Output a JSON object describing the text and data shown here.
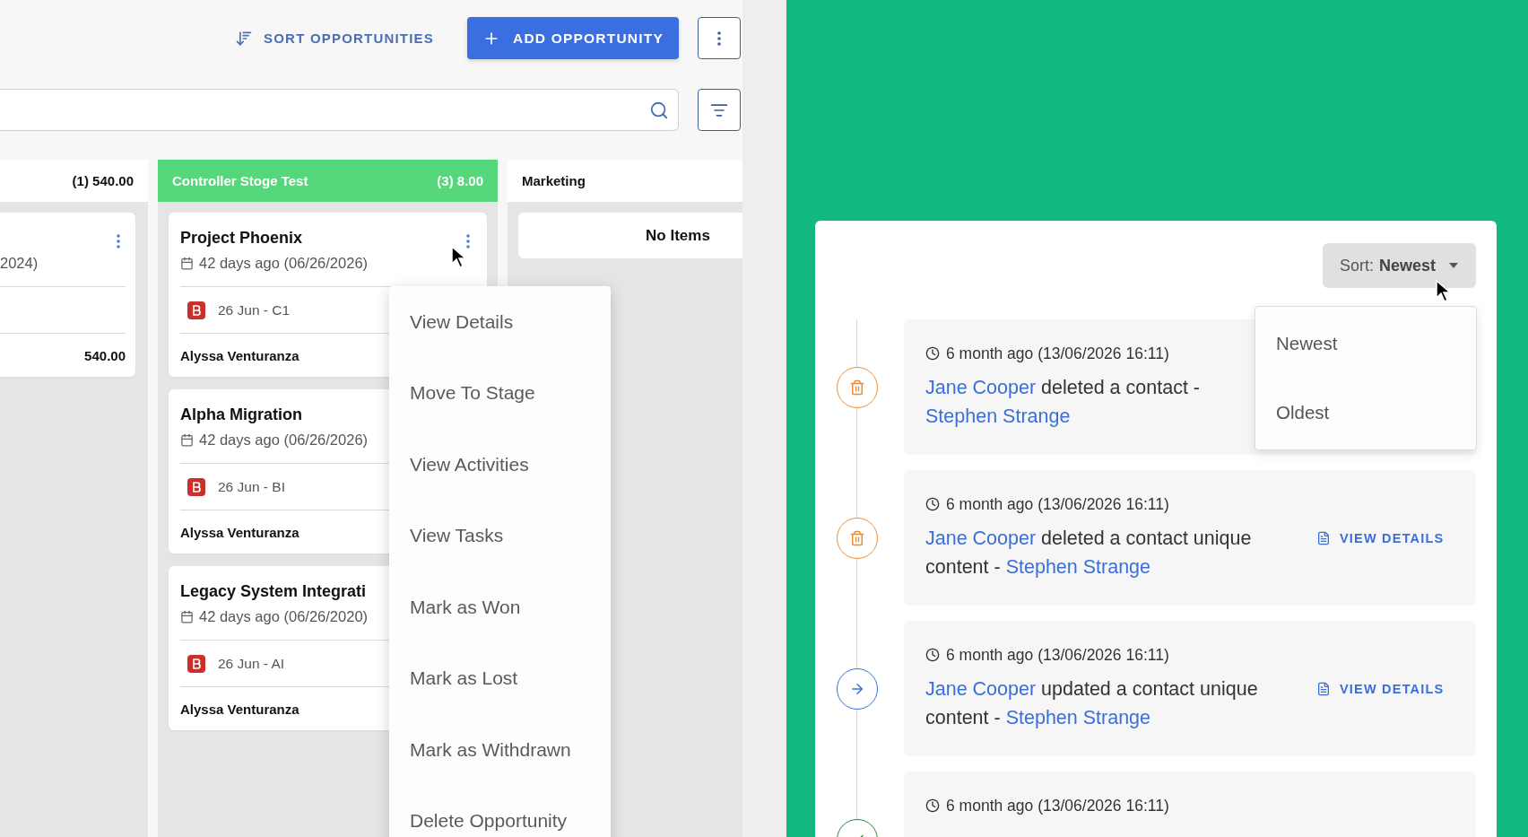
{
  "toolbar": {
    "sort_label": "SORT OPPORTUNITIES",
    "add_label": "ADD OPPORTUNITY"
  },
  "columns": [
    {
      "total": "(1) 540.00",
      "highlighted": false,
      "cards": [
        {
          "kind": "clipped",
          "date": "2024)",
          "amount": "540.00",
          "more_button": true
        }
      ]
    },
    {
      "name": "Controller Stoge Test",
      "total": "(3) 8.00",
      "highlighted": true,
      "cards": [
        {
          "kind": "full",
          "title": "Project Phoenix",
          "date": "42 days ago (06/26/2026)",
          "tag": "26 Jun - C1",
          "owner": "Alyssa Venturanza",
          "more_button": true
        },
        {
          "kind": "full",
          "title": "Alpha Migration",
          "date": "42 days ago (06/26/2026)",
          "tag": "26 Jun - BI",
          "owner": "Alyssa Venturanza"
        },
        {
          "kind": "full",
          "title": "Legacy System Integrati",
          "date": "42 days ago (06/26/2020)",
          "tag": "26 Jun - AI",
          "owner": "Alyssa Venturanza"
        }
      ]
    },
    {
      "name": "Marketing",
      "highlighted": false,
      "empty_text": "No Items"
    }
  ],
  "context_menu": {
    "items": [
      "View Details",
      "Move To Stage",
      "View Activities",
      "View Tasks",
      "Mark as Won",
      "Mark as Lost",
      "Mark as Withdrawn",
      "Delete Opportunity"
    ]
  },
  "activity": {
    "sort": {
      "label": "Sort:",
      "value": "Newest",
      "open": true,
      "options": [
        "Newest",
        "Oldest"
      ]
    },
    "items": [
      {
        "kind": "delete",
        "time": "6 month ago (13/06/2026 16:11)",
        "actor": "Jane Cooper",
        "action": "deleted a contact -",
        "target": "Stephen Strange"
      },
      {
        "kind": "delete",
        "time": "6 month ago (13/06/2026 16:11)",
        "actor": "Jane Cooper",
        "action": "deleted a contact unique content -",
        "target": "Stephen Strange",
        "link": "VIEW DETAILS"
      },
      {
        "kind": "update",
        "time": "6 month ago (13/06/2026 16:11)",
        "actor": "Jane Cooper",
        "action": "updated a contact unique content -",
        "target": "Stephen Strange",
        "link": "VIEW DETAILS"
      },
      {
        "kind": "complete",
        "time": "6 month ago (13/06/2026 16:11)"
      }
    ]
  }
}
